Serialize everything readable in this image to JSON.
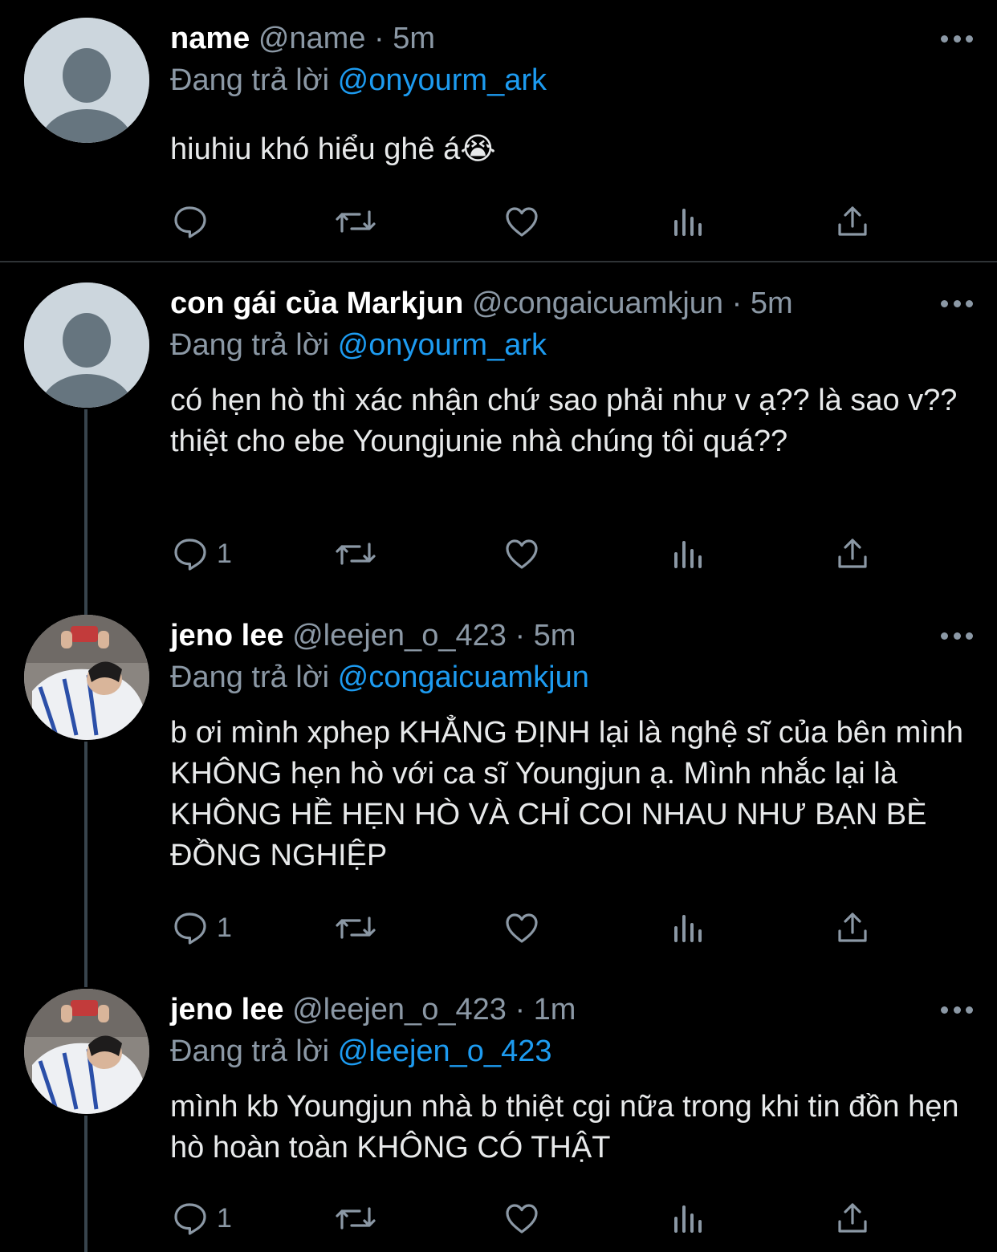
{
  "tweets": [
    {
      "name": "name",
      "handle": "@name",
      "time": "5m",
      "reply_prefix": "Đang trả lời",
      "reply_to": "@onyourm_ark",
      "text": "hiuhiu khó hiểu ghê á😭",
      "reply_count": "",
      "avatar": "default-avatar"
    },
    {
      "name": "con gái của Markjun",
      "handle": "@congaicuamkjun",
      "time": "5m",
      "reply_prefix": "Đang trả lời",
      "reply_to": "@onyourm_ark",
      "text": "có hẹn hò thì xác nhận chứ sao phải như v ạ?? là sao v?? thiệt cho ebe Youngjunie nhà chúng tôi quá??",
      "reply_count": "1",
      "avatar": "default-avatar"
    },
    {
      "name": "jeno lee",
      "handle": "@leejen_o_423",
      "time": "5m",
      "reply_prefix": "Đang trả lời",
      "reply_to": "@congaicuamkjun",
      "text": "b ơi mình xphep KHẲNG ĐỊNH lại là nghệ sĩ của bên mình KHÔNG hẹn hò với ca sĩ Youngjun ạ. Mình nhắc lại là KHÔNG HỀ HẸN HÒ VÀ CHỈ COI NHAU NHƯ BẠN BÈ ĐỒNG NGHIỆP",
      "reply_count": "1",
      "avatar": "photo-avatar"
    },
    {
      "name": "jeno lee",
      "handle": "@leejen_o_423",
      "time": "1m",
      "reply_prefix": "Đang trả lời",
      "reply_to": "@leejen_o_423",
      "text": "mình kb Youngjun nhà b thiệt cgi nữa trong khi tin đồn hẹn hò hoàn toàn KHÔNG CÓ THẬT",
      "reply_count": "1",
      "avatar": "photo-avatar"
    }
  ],
  "colors": {
    "background": "#000000",
    "text": "#e7e9ea",
    "secondary": "#8b98a5",
    "mention": "#1d9bf0",
    "thread_line": "#38444d"
  },
  "icons": [
    "reply-icon",
    "retweet-icon",
    "like-icon",
    "analytics-icon",
    "share-icon",
    "more-icon"
  ]
}
